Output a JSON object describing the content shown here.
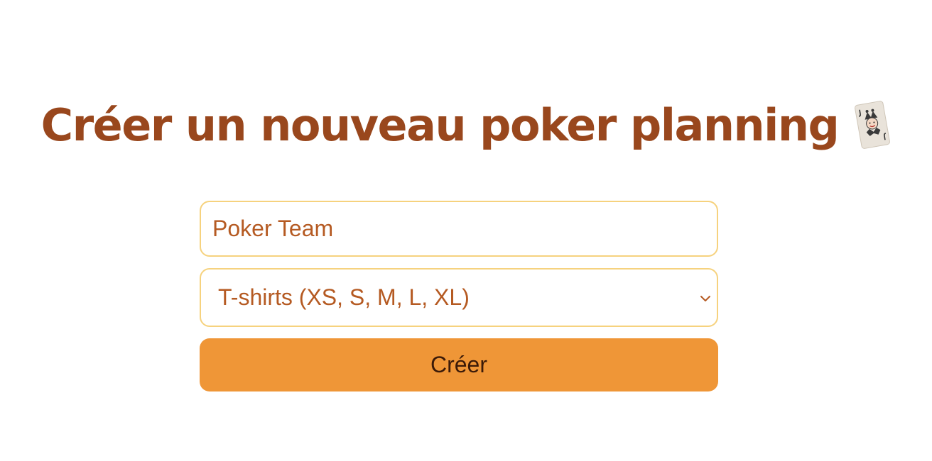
{
  "header": {
    "title": "Créer un nouveau poker planning",
    "title_icon": "joker-card-icon"
  },
  "form": {
    "name_value": "Poker Team",
    "scale_selected": "T-shirts (XS, S, M, L, XL)",
    "submit_label": "Créer"
  },
  "colors": {
    "title": "#99471d",
    "field_border": "#f6d27e",
    "field_text": "#b55a22",
    "button_bg": "#ef9637",
    "button_text": "#3b1a08"
  }
}
